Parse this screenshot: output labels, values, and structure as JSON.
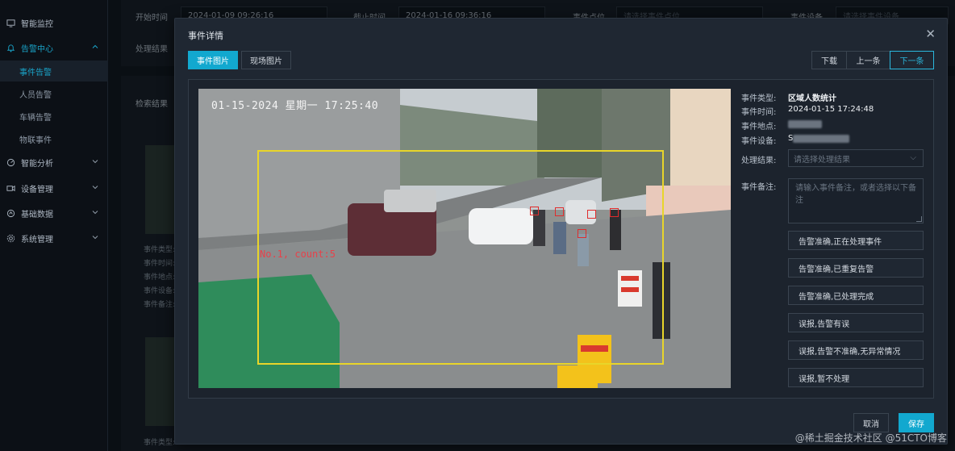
{
  "sidebar": {
    "items": [
      {
        "label": "智能监控",
        "icon": "monitor-icon"
      },
      {
        "label": "告警中心",
        "icon": "bell-icon",
        "active": true
      },
      {
        "label": "智能分析",
        "icon": "analysis-icon"
      },
      {
        "label": "设备管理",
        "icon": "camera-icon"
      },
      {
        "label": "基础数据",
        "icon": "data-icon"
      },
      {
        "label": "系统管理",
        "icon": "gear-icon"
      }
    ],
    "alarm_sub": [
      "事件告警",
      "人员告警",
      "车辆告警",
      "物联事件"
    ]
  },
  "filters": {
    "start_label": "开始时间",
    "start_value": "2024-01-09 09:26:16",
    "end_label": "截止时间",
    "end_value": "2024-01-16 09:36:16",
    "location_label": "事件点位",
    "location_placeholder": "请选择事件点位",
    "device_label": "事件设备",
    "device_placeholder": "请选择事件设备",
    "result_label": "处理结果"
  },
  "results": {
    "title": "检索结果",
    "card_lines": [
      "事件类型:",
      "事件时间:",
      "事件地点:",
      "事件设备:",
      "事件备注:"
    ],
    "card2_line": "事件类型:"
  },
  "modal": {
    "title": "事件详情",
    "tabs": [
      "事件图片",
      "现场图片"
    ],
    "download": "下载",
    "prev": "上一条",
    "next": "下一条",
    "image": {
      "timestamp": "01-15-2024 星期一 17:25:40",
      "roi_label": "No.1, count:5"
    },
    "info": {
      "type_label": "事件类型:",
      "type_value": "区域人数统计",
      "time_label": "事件时间:",
      "time_value": "2024-01-15 17:24:48",
      "location_label": "事件地点:",
      "device_label": "事件设备:",
      "device_prefix": "S",
      "result_label": "处理结果:",
      "result_placeholder": "请选择处理结果",
      "remark_label": "事件备注:",
      "remark_placeholder": "请输入事件备注，或者选择以下备注"
    },
    "quick_notes": [
      "告警准确,正在处理事件",
      "告警准确,已重复告警",
      "告警准确,已处理完成",
      "误报,告警有误",
      "误报,告警不准确,无异常情况",
      "误报,暂不处理"
    ],
    "cancel": "取消",
    "save": "保存"
  },
  "watermark": "@稀土掘金技术社区 @51CTO博客",
  "colors": {
    "accent": "#12a8cf",
    "roi": "#e8d52a",
    "head_box": "#e02c2c"
  }
}
